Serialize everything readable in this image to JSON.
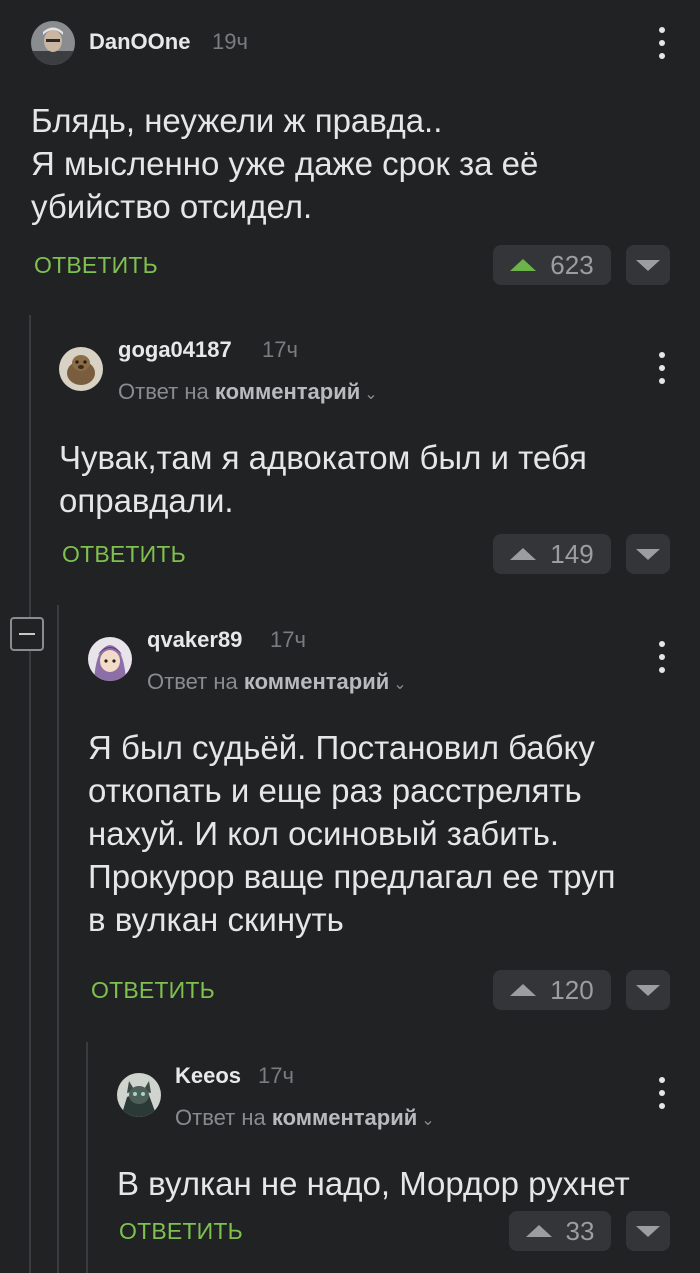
{
  "comments": [
    {
      "username": "DanOOne",
      "time": "19ч",
      "text": "Блядь, неужели ж правда..\nЯ мысленно уже даже срок за её\nубийство отсидел.",
      "reply_label": "ОТВЕТИТЬ",
      "votes": "623",
      "upvoted": true
    },
    {
      "username": "goga04187",
      "time": "17ч",
      "reply_prefix": "Ответ на",
      "reply_link": "комментарий",
      "text": "Чувак,там я адвокатом был и тебя\nоправдали.",
      "reply_label": "ОТВЕТИТЬ",
      "votes": "149"
    },
    {
      "username": "qvaker89",
      "time": "17ч",
      "reply_prefix": "Ответ на",
      "reply_link": "комментарий",
      "text": "Я был судьёй. Постановил бабку\nоткопать и еще раз расстрелять\nнахуй. И кол осиновый забить.\nПрокурор ваще предлагал ее труп\nв вулкан скинуть",
      "reply_label": "ОТВЕТИТЬ",
      "votes": "120"
    },
    {
      "username": "Keeos",
      "time": "17ч",
      "reply_prefix": "Ответ на",
      "reply_link": "комментарий",
      "text": "В вулкан не надо, Мордор рухнет",
      "reply_label": "ОТВЕТИТЬ",
      "votes": "33"
    }
  ],
  "colors": {
    "background": "#212224",
    "accent_green": "#7fc14f",
    "vote_bg": "#343538",
    "thread_line": "#3a3b3e"
  },
  "icons": [
    "kebab-menu-icon",
    "upvote-icon",
    "downvote-icon",
    "chevron-down-icon",
    "collapse-icon"
  ]
}
